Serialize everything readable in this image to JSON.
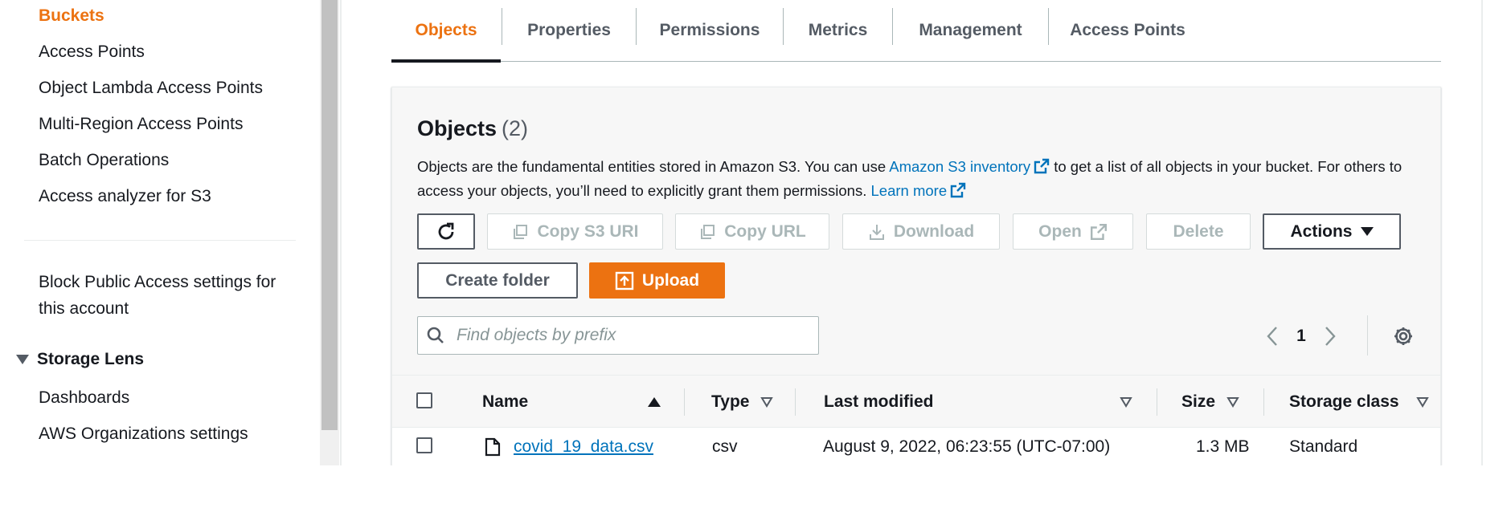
{
  "sidebar": {
    "items": [
      {
        "label": "Buckets",
        "active": true
      },
      {
        "label": "Access Points"
      },
      {
        "label": "Object Lambda Access Points"
      },
      {
        "label": "Multi-Region Access Points"
      },
      {
        "label": "Batch Operations"
      },
      {
        "label": "Access analyzer for S3"
      }
    ],
    "block_public_line1": "Block Public Access settings for",
    "block_public_line2": "this account",
    "storage_lens": {
      "label": "Storage Lens",
      "items": [
        {
          "label": "Dashboards"
        },
        {
          "label": "AWS Organizations settings"
        }
      ]
    }
  },
  "tabs": [
    {
      "label": "Objects",
      "active": true
    },
    {
      "label": "Properties"
    },
    {
      "label": "Permissions"
    },
    {
      "label": "Metrics"
    },
    {
      "label": "Management"
    },
    {
      "label": "Access Points"
    }
  ],
  "objects": {
    "title": "Objects",
    "count": "(2)",
    "desc_part1": "Objects are the fundamental entities stored in Amazon S3. You can use ",
    "desc_link1": "Amazon S3 inventory",
    "desc_part2": " to get a list of all objects in your bucket. For others to access your objects, you’ll need to explicitly grant them permissions. ",
    "desc_link2": "Learn more"
  },
  "toolbar": {
    "copy_s3_uri": "Copy S3 URI",
    "copy_url": "Copy URL",
    "download": "Download",
    "open": "Open",
    "delete": "Delete",
    "actions": "Actions",
    "create_folder": "Create folder",
    "upload": "Upload"
  },
  "search": {
    "placeholder": "Find objects by prefix",
    "value": ""
  },
  "pagination": {
    "page": "1"
  },
  "table": {
    "headers": {
      "name": "Name",
      "type": "Type",
      "last_modified": "Last modified",
      "size": "Size",
      "storage_class": "Storage class"
    },
    "rows": [
      {
        "name": "covid_19_data.csv",
        "type": "csv",
        "last_modified": "August 9, 2022, 06:23:55 (UTC-07:00)",
        "size": "1.3 MB",
        "storage_class": "Standard"
      }
    ]
  },
  "colors": {
    "accent": "#ec7211",
    "link": "#0073bb",
    "text": "#16191f",
    "muted": "#545b64",
    "disabled": "#aab7b8"
  }
}
